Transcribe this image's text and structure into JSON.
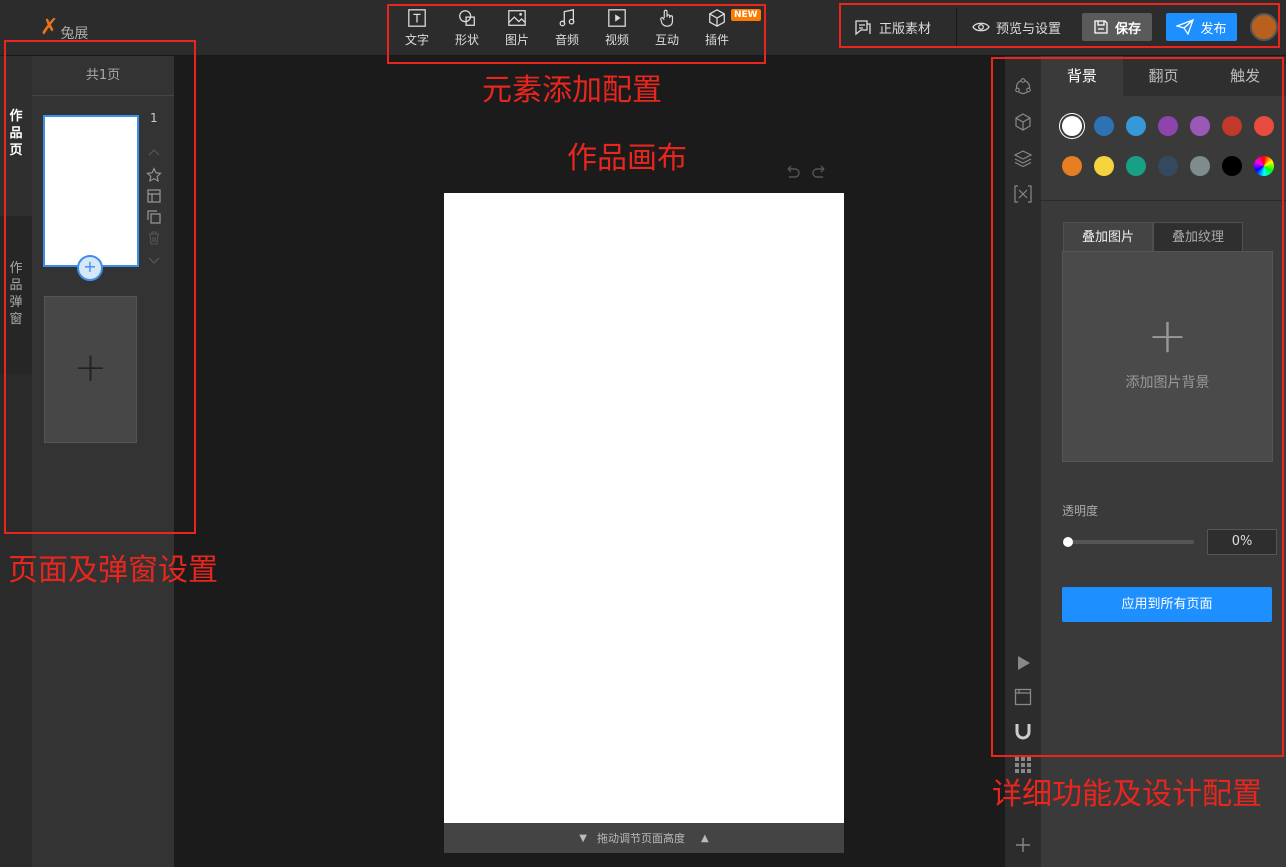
{
  "app": {
    "logo_text": "兔展"
  },
  "toolbar": {
    "items": [
      {
        "label": "文字",
        "icon": "text-icon"
      },
      {
        "label": "形状",
        "icon": "shape-icon"
      },
      {
        "label": "图片",
        "icon": "image-icon"
      },
      {
        "label": "音频",
        "icon": "music-icon"
      },
      {
        "label": "视频",
        "icon": "video-icon"
      },
      {
        "label": "互动",
        "icon": "hand-icon"
      },
      {
        "label": "插件",
        "icon": "plugin-icon"
      }
    ],
    "new_badge": "NEW"
  },
  "topright": {
    "licensed_assets": "正版素材",
    "preview_settings": "预览与设置",
    "save": "保存",
    "publish": "发布"
  },
  "left": {
    "tabs": [
      {
        "label": "作品页"
      },
      {
        "label": "作品弹窗"
      }
    ],
    "page_count": "共1页",
    "page_number": "1"
  },
  "canvas": {
    "resize_hint": "拖动调节页面高度"
  },
  "right": {
    "tabs": [
      {
        "label": "背景"
      },
      {
        "label": "翻页"
      },
      {
        "label": "触发"
      }
    ],
    "swatches": [
      "#ffffff",
      "#2d72b5",
      "#3498db",
      "#8e44ad",
      "#9b59b6",
      "#c0392b",
      "#e74c3c",
      "#e67e22",
      "#f5d33f",
      "#16a085",
      "#34495e",
      "#7f8c8d",
      "#000000"
    ],
    "subtabs": [
      {
        "label": "叠加图片"
      },
      {
        "label": "叠加纹理"
      }
    ],
    "add_bg_label": "添加图片背景",
    "opacity_label": "透明度",
    "opacity_value": "0%",
    "apply_all": "应用到所有页面"
  },
  "annotations": {
    "toolbar": "元素添加配置",
    "canvas": "作品画布",
    "pages": "页面及弹窗设置",
    "details": "详细功能及设计配置"
  },
  "colors": {
    "accent": "#1e8fff",
    "annotation": "#e8261e",
    "logo": "#e8731a"
  }
}
